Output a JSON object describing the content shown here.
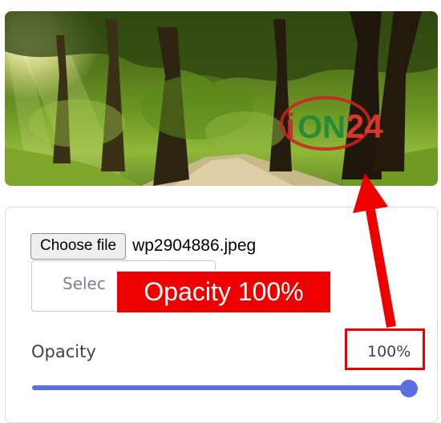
{
  "preview": {
    "watermark_text": "24"
  },
  "uploader": {
    "choose_file_label": "Choose file",
    "file_name": "wp2904886.jpeg",
    "select_placeholder": "Selec"
  },
  "opacity": {
    "label": "Opacity",
    "value_text": "100%",
    "value": 100,
    "min": 0,
    "max": 100
  },
  "annotation": {
    "callout_text": "Opacity 100%"
  },
  "colors": {
    "accent": "#5b6fe0",
    "annotation_red": "#ee0000",
    "card_border": "#d7dbe2"
  }
}
